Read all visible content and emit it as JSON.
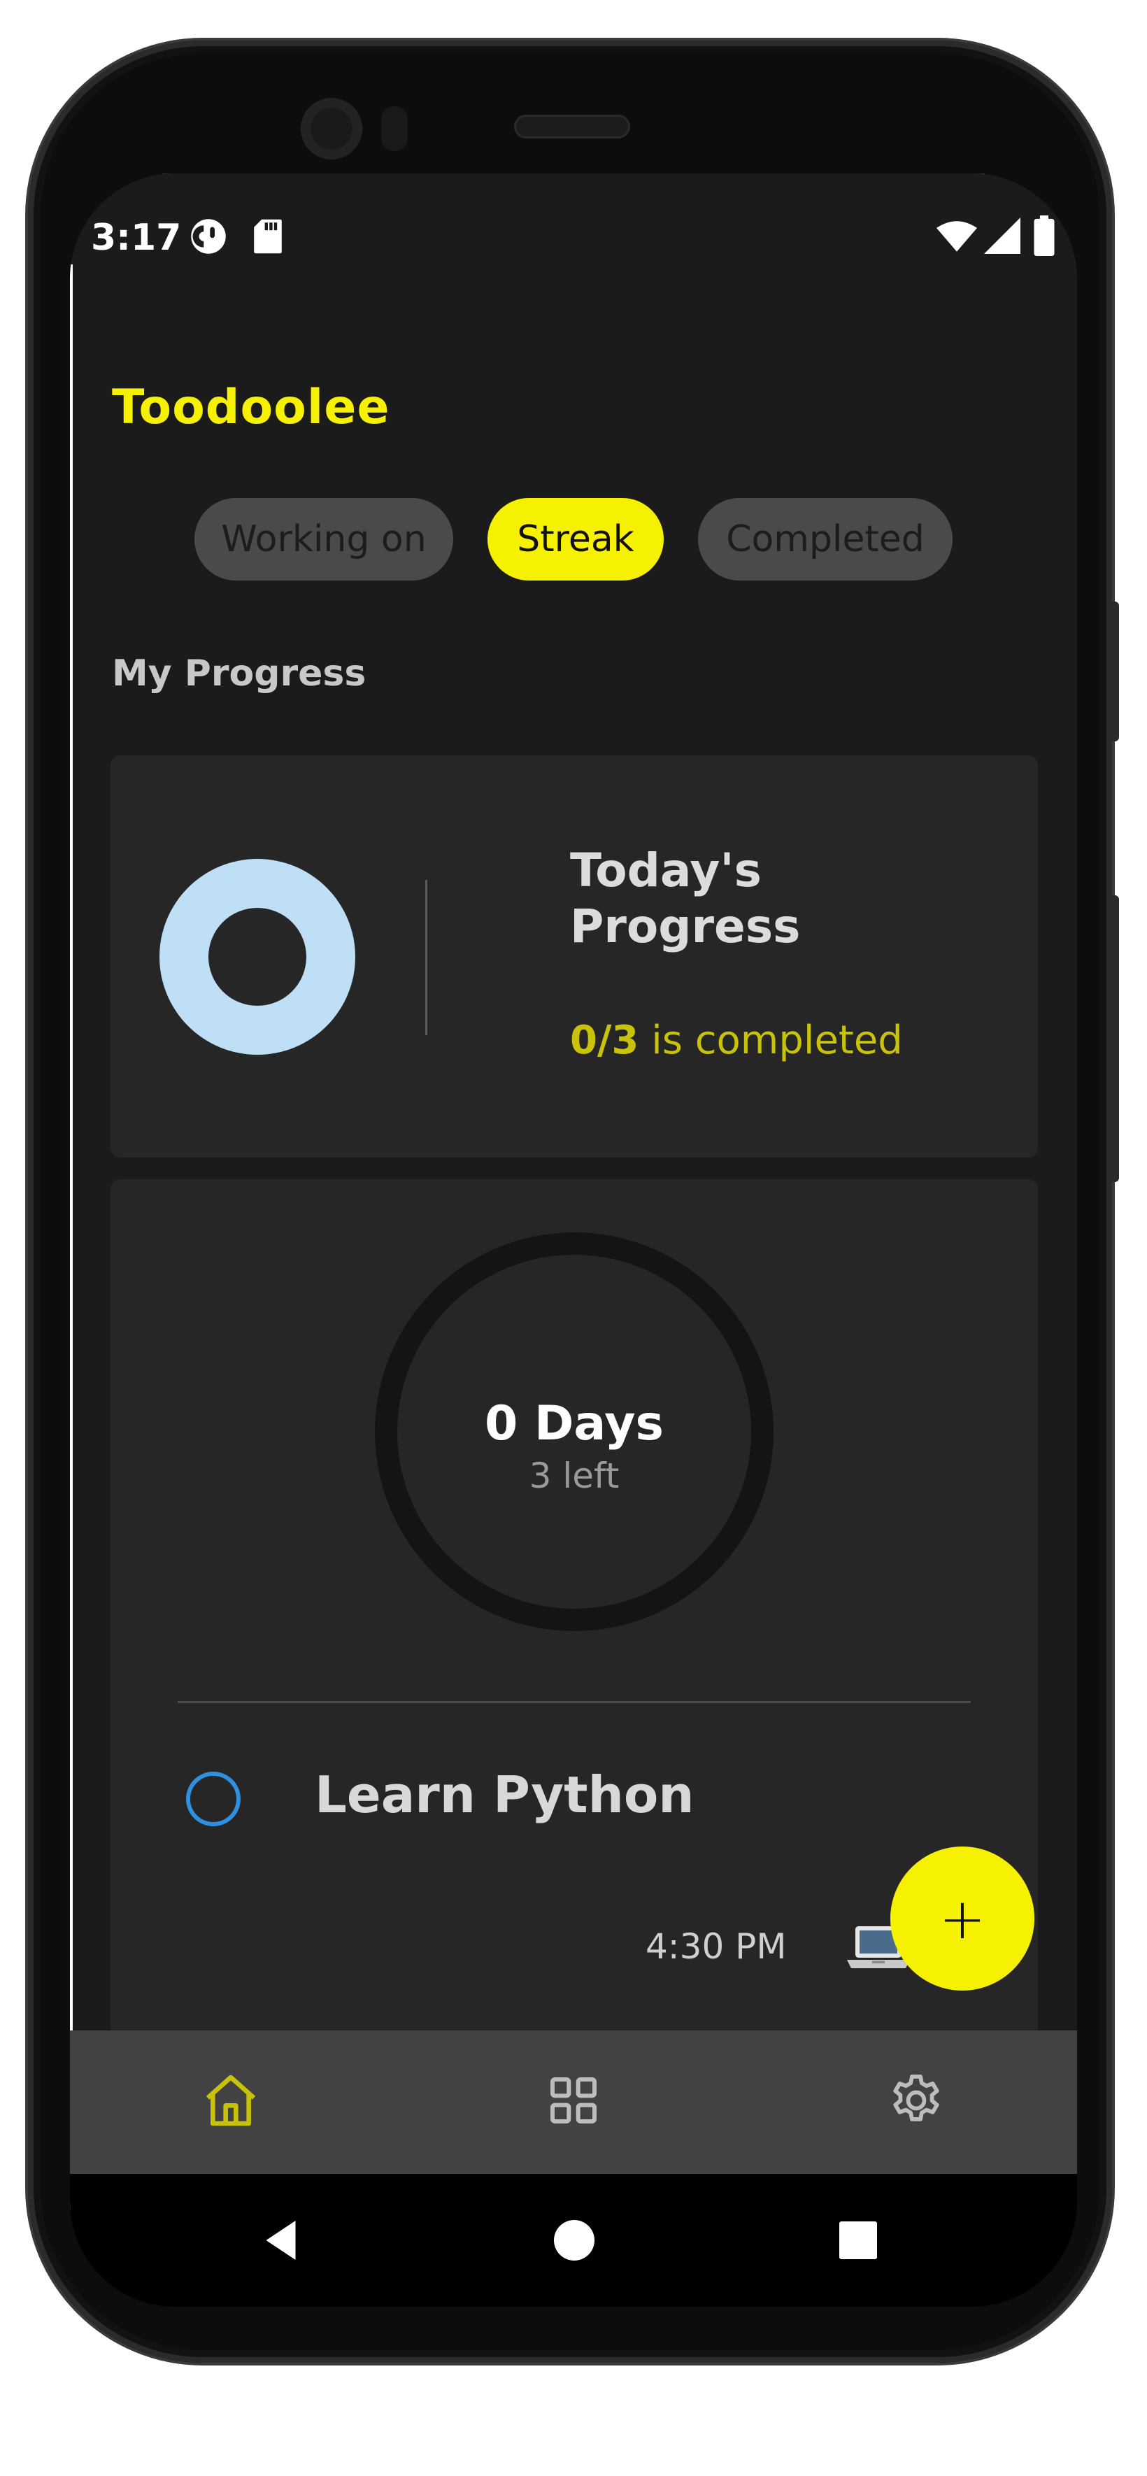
{
  "status_bar": {
    "time": "3:17",
    "left_icons": [
      "data-saver-icon",
      "sd-card-icon"
    ],
    "right_icons": [
      "wifi-icon",
      "cell-signal-icon",
      "battery-icon"
    ]
  },
  "app": {
    "title": "Toodoolee",
    "tabs": [
      {
        "label": "Working on",
        "active": false
      },
      {
        "label": "Streak",
        "active": true
      },
      {
        "label": "Completed",
        "active": false
      }
    ],
    "section_title": "My Progress"
  },
  "progress_card": {
    "title_line1": "Today's",
    "title_line2": "Progress",
    "count": "0/3",
    "count_suffix": "is completed",
    "completed_fraction": 0
  },
  "streak_card": {
    "days": "0 Days",
    "left": "3 left",
    "task": {
      "title": "Learn Python",
      "time": "4:30 PM",
      "icon": "laptop-icon"
    }
  },
  "fab": {
    "label": "+",
    "icon": "add-icon"
  },
  "bottom_nav": {
    "items": [
      {
        "icon": "home-icon",
        "active": true
      },
      {
        "icon": "grid-icon",
        "active": false
      },
      {
        "icon": "settings-icon",
        "active": false
      }
    ]
  },
  "system_nav": [
    "back-icon",
    "home-circle-icon",
    "recents-icon"
  ],
  "colors": {
    "accent": "#f6f100",
    "background": "#1b1b1b",
    "card": "#262626",
    "donut": "#bfdff7",
    "checkbox": "#2f8fe0",
    "nav_bar": "#424242"
  }
}
